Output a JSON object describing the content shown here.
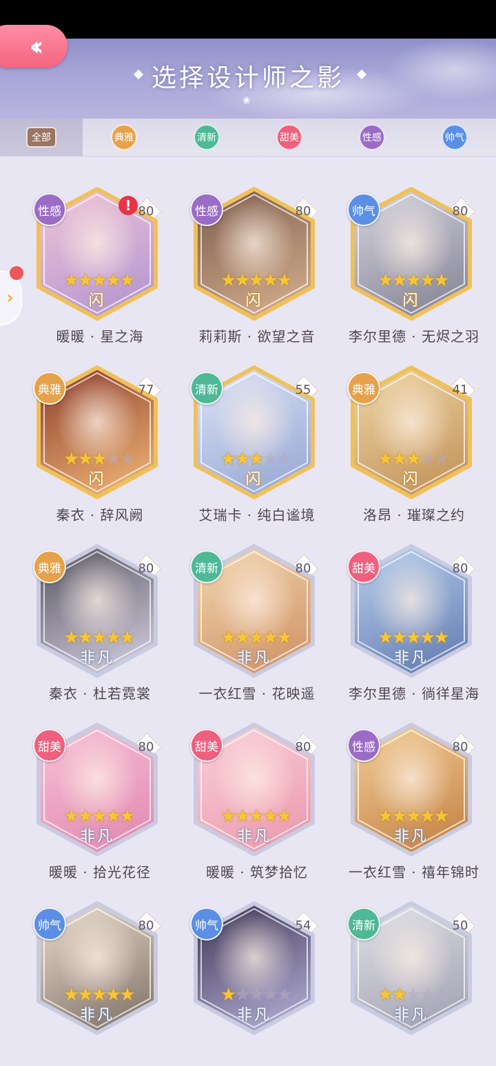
{
  "header": {
    "title": "选择设计师之影",
    "back_icon": "double-chevron-left-icon",
    "back_glyph": "‹‹",
    "flower_glyph": "❀"
  },
  "colors": {
    "sexy": "#9a6cc6",
    "elegant": "#e6a24a",
    "fresh": "#4fb896",
    "sweet": "#ef5f7e",
    "cool": "#5b8fe6",
    "gold_frame": "#f0c15a",
    "silver_frame": "#c9cbe0"
  },
  "tabs": [
    {
      "label": "全部",
      "style": "all",
      "active": true
    },
    {
      "label": "典雅",
      "style": "elegant",
      "active": false
    },
    {
      "label": "清新",
      "style": "fresh",
      "active": false
    },
    {
      "label": "甜美",
      "style": "sweet",
      "active": false
    },
    {
      "label": "性感",
      "style": "sexy",
      "active": false
    },
    {
      "label": "帅气",
      "style": "cool",
      "active": false
    }
  ],
  "side_arrow": {
    "glyph": "›",
    "icon": "chevron-right-icon"
  },
  "cards": [
    {
      "name": "暖暖 · 星之海",
      "style_label": "性感",
      "style": "sexy",
      "level": "80",
      "stars": 5,
      "grade": "gold",
      "grade_label": "闪",
      "alert": true,
      "art": [
        "#f3c6d6",
        "#b99ad2"
      ]
    },
    {
      "name": "莉莉斯 · 欲望之音",
      "style_label": "性感",
      "style": "sexy",
      "level": "80",
      "stars": 5,
      "grade": "gold",
      "grade_label": "闪",
      "alert": false,
      "art": [
        "#7a5a4a",
        "#c9a486"
      ]
    },
    {
      "name": "李尔里德 · 无烬之羽",
      "style_label": "帅气",
      "style": "cool",
      "level": "80",
      "stars": 5,
      "grade": "gold",
      "grade_label": "闪",
      "alert": false,
      "art": [
        "#d9d8e2",
        "#8e8d9e"
      ]
    },
    {
      "name": "秦衣 · 辞风阙",
      "style_label": "典雅",
      "style": "elegant",
      "level": "77",
      "stars": 3,
      "grade": "gold",
      "grade_label": "闪",
      "alert": false,
      "art": [
        "#8a3a2c",
        "#e3a66c"
      ]
    },
    {
      "name": "艾瑞卡 · 纯白谧境",
      "style_label": "清新",
      "style": "fresh",
      "level": "55",
      "stars": 3,
      "grade": "gold",
      "grade_label": "闪",
      "alert": false,
      "art": [
        "#dfe5f7",
        "#9faed8"
      ]
    },
    {
      "name": "洛昂 · 璀璨之约",
      "style_label": "典雅",
      "style": "elegant",
      "level": "41",
      "stars": 3,
      "grade": "gold",
      "grade_label": "闪",
      "alert": false,
      "art": [
        "#f0d9a8",
        "#c79a62"
      ]
    },
    {
      "name": "秦衣 · 杜若霓裳",
      "style_label": "典雅",
      "style": "elegant",
      "level": "80",
      "stars": 5,
      "grade": "silver",
      "grade_label": "非凡",
      "alert": false,
      "art": [
        "#54515e",
        "#c3bfd0"
      ]
    },
    {
      "name": "一衣红雪 · 花映遥",
      "style_label": "清新",
      "style": "fresh",
      "level": "80",
      "stars": 5,
      "grade": "silver",
      "grade_label": "非凡",
      "alert": false,
      "art": [
        "#f3d9b4",
        "#d49a6e"
      ]
    },
    {
      "name": "李尔里德 · 徜徉星海",
      "style_label": "甜美",
      "style": "sweet",
      "level": "80",
      "stars": 5,
      "grade": "silver",
      "grade_label": "非凡",
      "alert": false,
      "art": [
        "#bcd4f0",
        "#6e86b8"
      ]
    },
    {
      "name": "暖暖 · 拾光花径",
      "style_label": "甜美",
      "style": "sweet",
      "level": "80",
      "stars": 5,
      "grade": "silver",
      "grade_label": "非凡",
      "alert": false,
      "art": [
        "#f7c4d8",
        "#e58fb5"
      ]
    },
    {
      "name": "暖暖 · 筑梦拾忆",
      "style_label": "甜美",
      "style": "sweet",
      "level": "80",
      "stars": 5,
      "grade": "silver",
      "grade_label": "非凡",
      "alert": false,
      "art": [
        "#f9d3dc",
        "#ee9fb2"
      ]
    },
    {
      "name": "一衣红雪 · 禧年锦时",
      "style_label": "性感",
      "style": "sexy",
      "level": "80",
      "stars": 5,
      "grade": "silver",
      "grade_label": "非凡",
      "alert": false,
      "art": [
        "#f4d29c",
        "#c98a4e"
      ]
    },
    {
      "name": "",
      "style_label": "帅气",
      "style": "cool",
      "level": "80",
      "stars": 5,
      "grade": "silver",
      "grade_label": "非凡",
      "alert": false,
      "art": [
        "#ece0d2",
        "#8e7f74"
      ]
    },
    {
      "name": "",
      "style_label": "帅气",
      "style": "cool",
      "level": "54",
      "stars": 1,
      "grade": "silver",
      "grade_label": "非凡",
      "alert": false,
      "art": [
        "#3b3350",
        "#a6a0c8"
      ]
    },
    {
      "name": "",
      "style_label": "清新",
      "style": "fresh",
      "level": "50",
      "stars": 2,
      "grade": "silver",
      "grade_label": "非凡",
      "alert": false,
      "art": [
        "#e4e4ea",
        "#a8a8b8"
      ]
    }
  ]
}
